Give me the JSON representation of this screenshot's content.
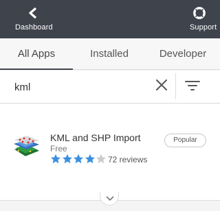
{
  "header": {
    "dashboard_label": "Dashboard",
    "support_label": "Support",
    "dashboard_icon": "chevron-left-icon",
    "support_icon": "lifebuoy-icon",
    "background_color": "#3e434c"
  },
  "tabs": [
    {
      "label": "All Apps",
      "active": true
    },
    {
      "label": "Installed",
      "active": false
    },
    {
      "label": "Developer",
      "active": false
    }
  ],
  "search": {
    "value": "kml",
    "clear_icon": "close-icon",
    "filter_icon": "filter-icon"
  },
  "results": [
    {
      "name": "KML and SHP Import",
      "price": "Free",
      "rating": 4,
      "max_rating": 5,
      "reviews": "72 reviews",
      "badge": "Popular",
      "icon": "map-layers-icon"
    }
  ],
  "footer": {
    "more_icon": "chevron-down-icon"
  },
  "colors": {
    "star_filled": "#3c8fde",
    "star_empty": "#cccccc"
  }
}
